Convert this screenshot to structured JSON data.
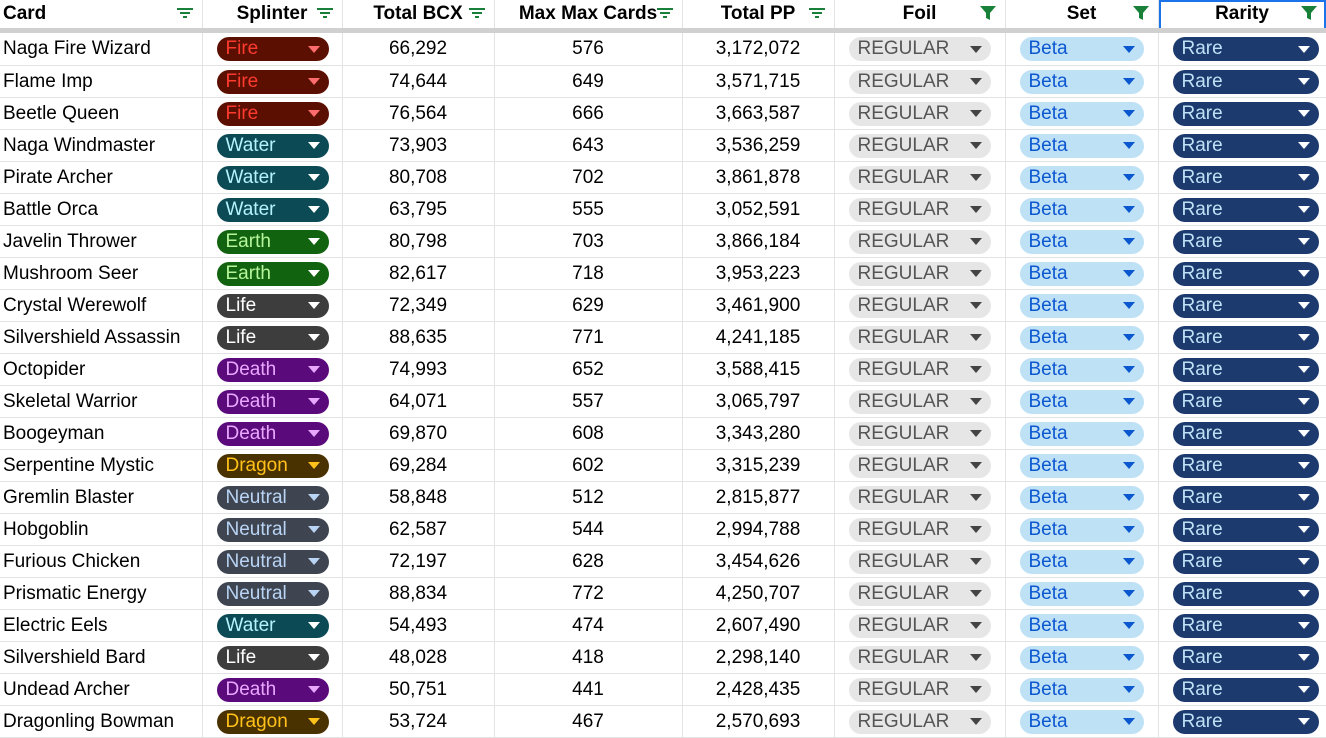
{
  "headers": {
    "card": "Card",
    "splinter": "Splinter",
    "total_bcx": "Total BCX",
    "max_max_cards": "Max Max Cards",
    "total_pp": "Total PP",
    "foil": "Foil",
    "set": "Set",
    "rarity": "Rarity"
  },
  "filter_colors": {
    "inactive": "#188038",
    "active": "#188038"
  },
  "splinter_styles": {
    "Fire": {
      "bg": "#5b0f00",
      "fg": "#ff3b30",
      "arrow": "#ff6d6d"
    },
    "Water": {
      "bg": "#0c4a55",
      "fg": "#b5f2ff",
      "arrow": "#ffffff"
    },
    "Earth": {
      "bg": "#11630f",
      "fg": "#b7f59a",
      "arrow": "#ffffff"
    },
    "Life": {
      "bg": "#3d3d3d",
      "fg": "#ffffff",
      "arrow": "#ffffff"
    },
    "Death": {
      "bg": "#5a0a7a",
      "fg": "#e9a8ff",
      "arrow": "#e9a8ff"
    },
    "Dragon": {
      "bg": "#4a3100",
      "fg": "#ffc21a",
      "arrow": "#ffc21a"
    },
    "Neutral": {
      "bg": "#3e4550",
      "fg": "#b9d4f5",
      "arrow": "#b9d4f5"
    }
  },
  "rows": [
    {
      "card": "Naga Fire Wizard",
      "splinter": "Fire",
      "total_bcx": "66,292",
      "max_max_cards": "576",
      "total_pp": "3,172,072",
      "foil": "REGULAR",
      "set": "Beta",
      "rarity": "Rare"
    },
    {
      "card": "Flame Imp",
      "splinter": "Fire",
      "total_bcx": "74,644",
      "max_max_cards": "649",
      "total_pp": "3,571,715",
      "foil": "REGULAR",
      "set": "Beta",
      "rarity": "Rare"
    },
    {
      "card": "Beetle Queen",
      "splinter": "Fire",
      "total_bcx": "76,564",
      "max_max_cards": "666",
      "total_pp": "3,663,587",
      "foil": "REGULAR",
      "set": "Beta",
      "rarity": "Rare"
    },
    {
      "card": "Naga Windmaster",
      "splinter": "Water",
      "total_bcx": "73,903",
      "max_max_cards": "643",
      "total_pp": "3,536,259",
      "foil": "REGULAR",
      "set": "Beta",
      "rarity": "Rare"
    },
    {
      "card": "Pirate Archer",
      "splinter": "Water",
      "total_bcx": "80,708",
      "max_max_cards": "702",
      "total_pp": "3,861,878",
      "foil": "REGULAR",
      "set": "Beta",
      "rarity": "Rare"
    },
    {
      "card": "Battle Orca",
      "splinter": "Water",
      "total_bcx": "63,795",
      "max_max_cards": "555",
      "total_pp": "3,052,591",
      "foil": "REGULAR",
      "set": "Beta",
      "rarity": "Rare"
    },
    {
      "card": "Javelin Thrower",
      "splinter": "Earth",
      "total_bcx": "80,798",
      "max_max_cards": "703",
      "total_pp": "3,866,184",
      "foil": "REGULAR",
      "set": "Beta",
      "rarity": "Rare"
    },
    {
      "card": "Mushroom Seer",
      "splinter": "Earth",
      "total_bcx": "82,617",
      "max_max_cards": "718",
      "total_pp": "3,953,223",
      "foil": "REGULAR",
      "set": "Beta",
      "rarity": "Rare"
    },
    {
      "card": "Crystal Werewolf",
      "splinter": "Life",
      "total_bcx": "72,349",
      "max_max_cards": "629",
      "total_pp": "3,461,900",
      "foil": "REGULAR",
      "set": "Beta",
      "rarity": "Rare"
    },
    {
      "card": "Silvershield Assassin",
      "splinter": "Life",
      "total_bcx": "88,635",
      "max_max_cards": "771",
      "total_pp": "4,241,185",
      "foil": "REGULAR",
      "set": "Beta",
      "rarity": "Rare"
    },
    {
      "card": "Octopider",
      "splinter": "Death",
      "total_bcx": "74,993",
      "max_max_cards": "652",
      "total_pp": "3,588,415",
      "foil": "REGULAR",
      "set": "Beta",
      "rarity": "Rare"
    },
    {
      "card": "Skeletal Warrior",
      "splinter": "Death",
      "total_bcx": "64,071",
      "max_max_cards": "557",
      "total_pp": "3,065,797",
      "foil": "REGULAR",
      "set": "Beta",
      "rarity": "Rare"
    },
    {
      "card": "Boogeyman",
      "splinter": "Death",
      "total_bcx": "69,870",
      "max_max_cards": "608",
      "total_pp": "3,343,280",
      "foil": "REGULAR",
      "set": "Beta",
      "rarity": "Rare"
    },
    {
      "card": "Serpentine Mystic",
      "splinter": "Dragon",
      "total_bcx": "69,284",
      "max_max_cards": "602",
      "total_pp": "3,315,239",
      "foil": "REGULAR",
      "set": "Beta",
      "rarity": "Rare"
    },
    {
      "card": "Gremlin Blaster",
      "splinter": "Neutral",
      "total_bcx": "58,848",
      "max_max_cards": "512",
      "total_pp": "2,815,877",
      "foil": "REGULAR",
      "set": "Beta",
      "rarity": "Rare"
    },
    {
      "card": "Hobgoblin",
      "splinter": "Neutral",
      "total_bcx": "62,587",
      "max_max_cards": "544",
      "total_pp": "2,994,788",
      "foil": "REGULAR",
      "set": "Beta",
      "rarity": "Rare"
    },
    {
      "card": "Furious Chicken",
      "splinter": "Neutral",
      "total_bcx": "72,197",
      "max_max_cards": "628",
      "total_pp": "3,454,626",
      "foil": "REGULAR",
      "set": "Beta",
      "rarity": "Rare"
    },
    {
      "card": "Prismatic Energy",
      "splinter": "Neutral",
      "total_bcx": "88,834",
      "max_max_cards": "772",
      "total_pp": "4,250,707",
      "foil": "REGULAR",
      "set": "Beta",
      "rarity": "Rare"
    },
    {
      "card": "Electric Eels",
      "splinter": "Water",
      "total_bcx": "54,493",
      "max_max_cards": "474",
      "total_pp": "2,607,490",
      "foil": "REGULAR",
      "set": "Beta",
      "rarity": "Rare"
    },
    {
      "card": "Silvershield Bard",
      "splinter": "Life",
      "total_bcx": "48,028",
      "max_max_cards": "418",
      "total_pp": "2,298,140",
      "foil": "REGULAR",
      "set": "Beta",
      "rarity": "Rare"
    },
    {
      "card": "Undead Archer",
      "splinter": "Death",
      "total_bcx": "50,751",
      "max_max_cards": "441",
      "total_pp": "2,428,435",
      "foil": "REGULAR",
      "set": "Beta",
      "rarity": "Rare"
    },
    {
      "card": "Dragonling Bowman",
      "splinter": "Dragon",
      "total_bcx": "53,724",
      "max_max_cards": "467",
      "total_pp": "2,570,693",
      "foil": "REGULAR",
      "set": "Beta",
      "rarity": "Rare"
    }
  ]
}
